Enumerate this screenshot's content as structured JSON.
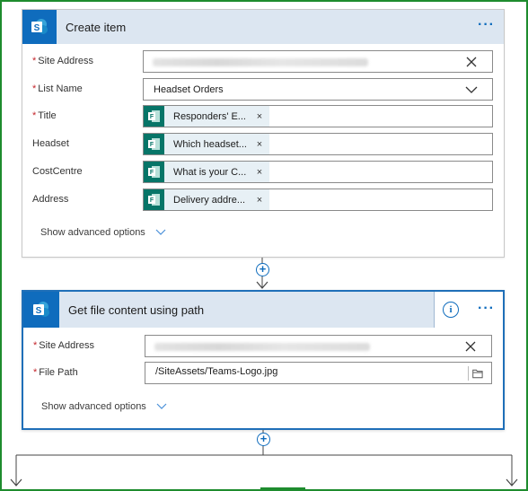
{
  "card1": {
    "title": "Create item",
    "more_label": "···",
    "fields": [
      {
        "label": "Site Address",
        "required": true,
        "type": "blurred"
      },
      {
        "label": "List Name",
        "required": true,
        "type": "dropdown",
        "value": "Headset Orders"
      },
      {
        "label": "Title",
        "required": true,
        "type": "token",
        "token": "Responders' E..."
      },
      {
        "label": "Headset",
        "required": false,
        "type": "token",
        "token": "Which headset..."
      },
      {
        "label": "CostCentre",
        "required": false,
        "type": "token",
        "token": "What is your C..."
      },
      {
        "label": "Address",
        "required": false,
        "type": "token",
        "token": "Delivery addre..."
      }
    ],
    "advanced_label": "Show advanced options"
  },
  "card2": {
    "title": "Get file content using path",
    "more_label": "···",
    "info_label": "i",
    "fields": [
      {
        "label": "Site Address",
        "required": true,
        "type": "blurred"
      },
      {
        "label": "File Path",
        "required": true,
        "type": "file",
        "value": "/SiteAssets/Teams-Logo.jpg"
      }
    ],
    "advanced_label": "Show advanced options"
  },
  "req_mark": "*",
  "token_remove": "×",
  "plus_label": "+",
  "colors": {
    "accent": "#0f6cbd",
    "header_bg": "#dce6f1",
    "forms_green": "#077568",
    "frame_green": "#1e8c2e",
    "required_red": "#c4252b"
  }
}
